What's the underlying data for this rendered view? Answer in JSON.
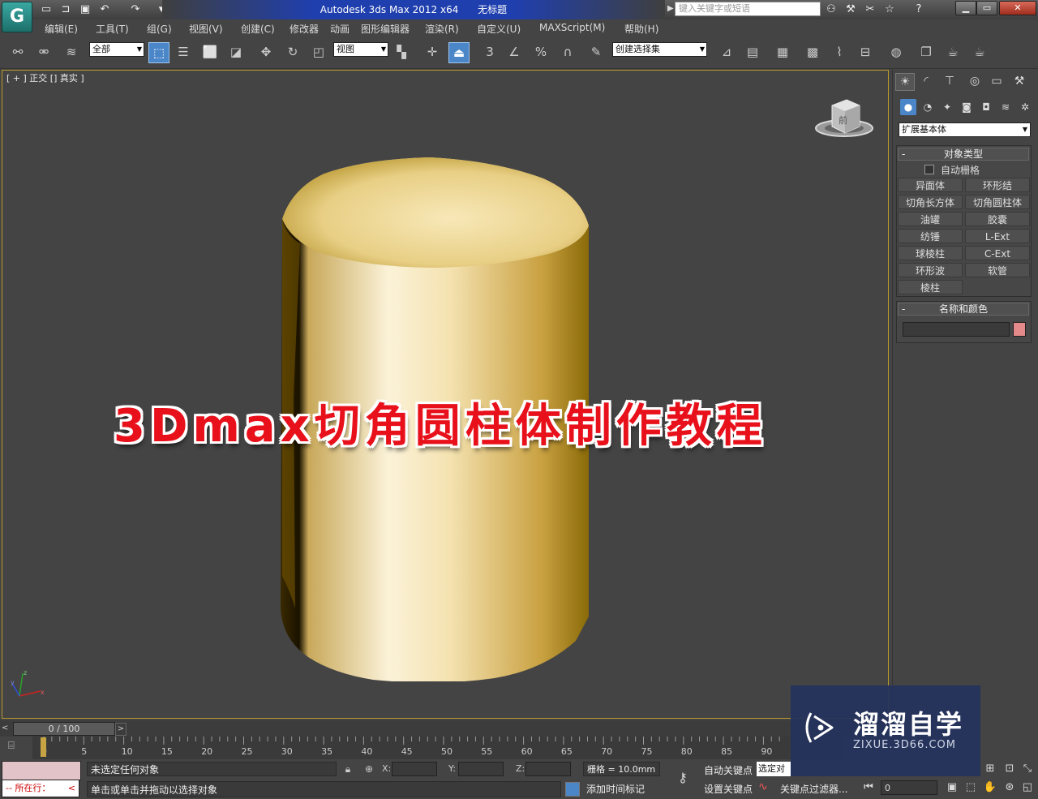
{
  "window": {
    "app_title": "Autodesk 3ds Max  2012 x64",
    "doc_title": "无标题",
    "search_placeholder": "键入关键字或短语"
  },
  "menu": [
    "编辑(E)",
    "工具(T)",
    "组(G)",
    "视图(V)",
    "创建(C)",
    "修改器",
    "动画",
    "图形编辑器",
    "渲染(R)",
    "自定义(U)",
    "MAXScript(M)",
    "帮助(H)"
  ],
  "toolbar": {
    "selection_filter": "全部",
    "reference_coord": "视图",
    "named_selection": "创建选择集",
    "snap_3": "3",
    "percent": "%"
  },
  "viewport": {
    "label": "[ + ] 正交 [] 真实 ]",
    "overlay_title": "3Dmax切角圆柱体制作教程",
    "viewcube_label": "前"
  },
  "command_panel": {
    "subcategory": "扩展基本体",
    "object_type_title": "对象类型",
    "autogrid_label": "自动栅格",
    "buttons": [
      "异面体",
      "环形结",
      "切角长方体",
      "切角圆柱体",
      "油罐",
      "胶囊",
      "纺锤",
      "L-Ext",
      "球棱柱",
      "C-Ext",
      "环形波",
      "软管",
      "棱柱"
    ],
    "name_color_title": "名称和颜色",
    "color": "#e58a8a"
  },
  "timeline": {
    "slider_label": "0 / 100",
    "ticks": [
      "0",
      "5",
      "10",
      "15",
      "20",
      "25",
      "30",
      "35",
      "40",
      "45",
      "50",
      "55",
      "60",
      "65",
      "70",
      "75",
      "80",
      "85",
      "90"
    ]
  },
  "status": {
    "current_label": "所在行：",
    "message_top": "未选定任何对象",
    "message_bottom": "单击或单击并拖动以选择对象",
    "x_label": "X:",
    "y_label": "Y:",
    "z_label": "Z:",
    "grid": "栅格 = 10.0mm",
    "add_time_tag": "添加时间标记",
    "auto_key": "自动关键点",
    "set_key": "设置关键点",
    "selected": "选定对",
    "key_filter": "关键点过滤器...",
    "frame": "0"
  },
  "watermark": {
    "brand": "溜溜自学",
    "url": "ZIXUE.3D66.COM"
  }
}
